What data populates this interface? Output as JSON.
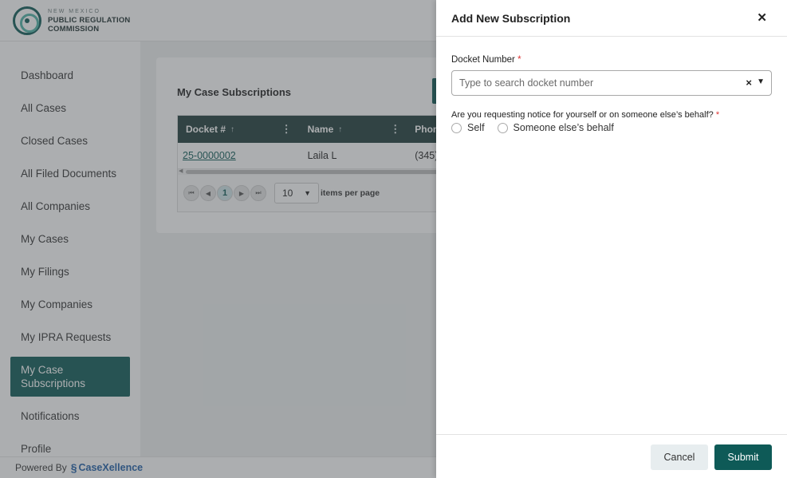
{
  "header": {
    "logo_line1": "NEW MEXICO",
    "logo_line2": "PUBLIC REGULATION",
    "logo_line3": "COMMISSION"
  },
  "sidebar": {
    "items": [
      {
        "label": "Dashboard"
      },
      {
        "label": "All Cases"
      },
      {
        "label": "Closed Cases"
      },
      {
        "label": "All Filed Documents"
      },
      {
        "label": "All Companies"
      },
      {
        "label": "My Cases"
      },
      {
        "label": "My Filings"
      },
      {
        "label": "My Companies"
      },
      {
        "label": "My IPRA Requests"
      },
      {
        "label": "My Case Subscriptions",
        "active": true
      },
      {
        "label": "Notifications"
      },
      {
        "label": "Profile"
      }
    ]
  },
  "footer": {
    "powered_by": "Powered By",
    "brand": "CaseXellence"
  },
  "main": {
    "title": "My Case Subscriptions",
    "grid": {
      "columns": [
        "Docket #",
        "Name",
        "Phone"
      ],
      "rows": [
        {
          "docket": "25-0000002",
          "name": "Laila L",
          "phone": "(345)"
        }
      ],
      "pager": {
        "current_page": "1",
        "per_page": "10",
        "per_page_label": "items per page"
      }
    }
  },
  "drawer": {
    "title": "Add New Subscription",
    "docket_label": "Docket Number",
    "docket_placeholder": "Type to search docket number",
    "notice_label": "Are you requesting notice for yourself or on someone else’s behalf?",
    "required_mark": "*",
    "options": [
      "Self",
      "Someone else’s behalf"
    ],
    "cancel_label": "Cancel",
    "submit_label": "Submit"
  },
  "icons": {
    "close": "close-icon",
    "clear": "clear-icon",
    "caret": "chevron-down-icon",
    "sort": "sort-arrow-icon",
    "kebab": "kebab-menu-icon"
  },
  "colors": {
    "brand": "#0e5a57",
    "grid_header": "#1f3c3b",
    "accent_light": "#4fb3a6",
    "powered_brand": "#1f5fa8"
  }
}
